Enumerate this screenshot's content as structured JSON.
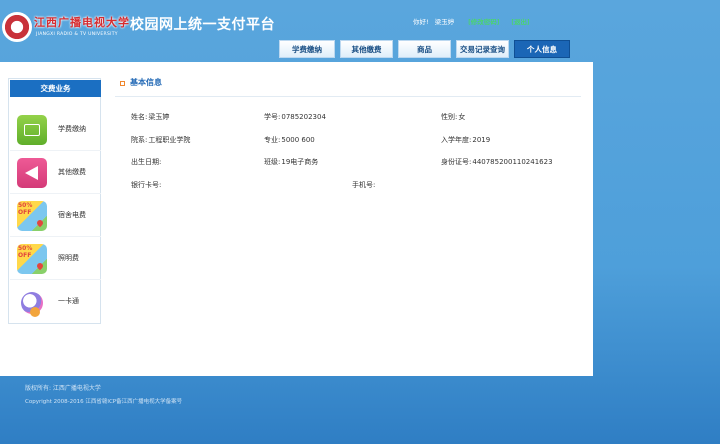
{
  "header": {
    "logo_name": "江西广播电视大学",
    "logo_en": "JIANGXI RADIO & TV UNIVERSITY",
    "site_title": "校园网上统一支付平台",
    "greeting": "你好!",
    "user_name": "梁玉婷",
    "link_modify": "[修改密码]",
    "link_logout": "[退出]"
  },
  "nav": {
    "tabs": [
      {
        "label": "学费缴纳",
        "active": false
      },
      {
        "label": "其他缴费",
        "active": false
      },
      {
        "label": "商品",
        "active": false
      },
      {
        "label": "交易记录查询",
        "active": false
      },
      {
        "label": "个人信息",
        "active": true
      }
    ]
  },
  "sidebar": {
    "title": "交费业务",
    "items": [
      {
        "label": "学费缴纳",
        "icon": "money-icon"
      },
      {
        "label": "其他缴费",
        "icon": "megaphone-icon"
      },
      {
        "label": "宿舍电费",
        "icon": "discount-map-icon",
        "badge": "50% OFF"
      },
      {
        "label": "照明费",
        "icon": "discount-map-icon",
        "badge": "50% OFF"
      },
      {
        "label": "一卡通",
        "icon": "card-icon"
      }
    ]
  },
  "section": {
    "title": "基本信息"
  },
  "info": {
    "name_label": "姓名:",
    "name_value": "梁玉婷",
    "sid_label": "学号:",
    "sid_value": "0785202304",
    "gender_label": "性别:",
    "gender_value": "女",
    "dept_label": "院系:",
    "dept_value": "工程职业学院",
    "major_label": "专业:",
    "major_value": "5000 600",
    "year_label": "入学年度:",
    "year_value": "2019",
    "birth_label": "出生日期:",
    "birth_value": "",
    "class_label": "班级:",
    "class_value": "19电子商务",
    "idcard_label": "身份证号:",
    "idcard_value": "440785200110241623",
    "bank_label": "银行卡号:",
    "bank_value": "",
    "phone_label": "手机号:",
    "phone_value": ""
  },
  "footer": {
    "copyright_owner": "版权所有: 江西广播电视大学",
    "copyright_line": "Copyright 2008-2016  江西省赣ICP备江西广播电视大学备案号"
  },
  "colors": {
    "background": "#4e9fda",
    "nav_active": "#1b66b6",
    "sidebar_header": "#1b6fc2",
    "link_green": "#45e83f",
    "section_title": "#2168b5"
  }
}
